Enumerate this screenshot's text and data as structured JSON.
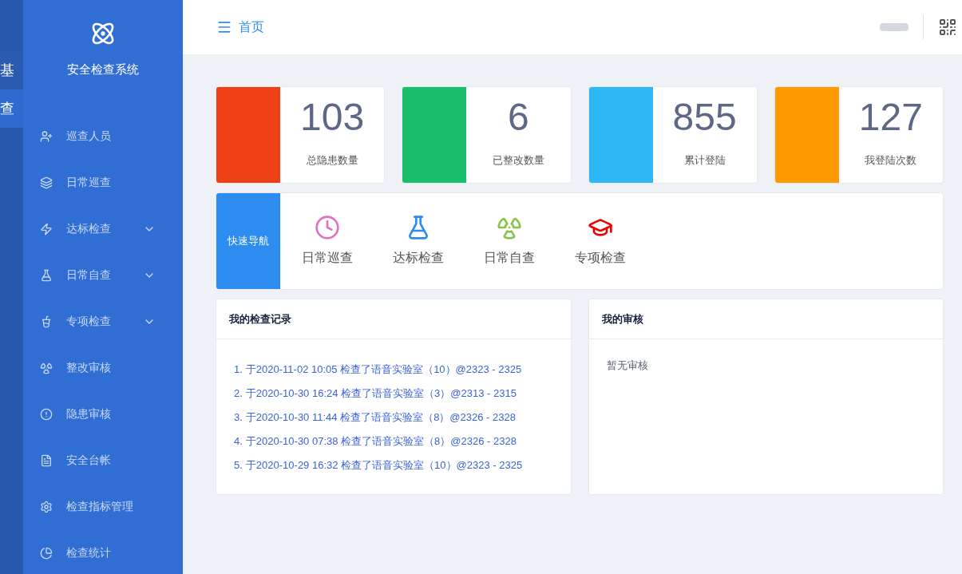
{
  "side_strip": [
    {
      "label": "基",
      "selected": false
    },
    {
      "label": "查",
      "selected": true
    }
  ],
  "brand": {
    "title": "安全检查系统"
  },
  "menu": [
    {
      "label": "巡查人员",
      "expandable": false
    },
    {
      "label": "日常巡查",
      "expandable": false
    },
    {
      "label": "达标检查",
      "expandable": true
    },
    {
      "label": "日常自查",
      "expandable": true
    },
    {
      "label": "专项检查",
      "expandable": true
    },
    {
      "label": "整改审核",
      "expandable": false
    },
    {
      "label": "隐患审核",
      "expandable": false
    },
    {
      "label": "安全台帐",
      "expandable": false
    },
    {
      "label": "检查指标管理",
      "expandable": false
    },
    {
      "label": "检查统计",
      "expandable": false
    }
  ],
  "header": {
    "breadcrumb": "首页"
  },
  "stats": [
    {
      "value": "103",
      "label": "总隐患数量",
      "color": "#ed4014"
    },
    {
      "value": "6",
      "label": "已整改数量",
      "color": "#19be6b"
    },
    {
      "value": "855",
      "label": "累计登陆",
      "color": "#2db7f5"
    },
    {
      "value": "127",
      "label": "我登陆次数",
      "color": "#ff9900"
    }
  ],
  "quick_nav": {
    "title": "快速导航",
    "items": [
      {
        "label": "日常巡查"
      },
      {
        "label": "达标检查"
      },
      {
        "label": "日常自查"
      },
      {
        "label": "专项检查"
      }
    ]
  },
  "records": {
    "title": "我的检查记录",
    "items": [
      {
        "index": "1.",
        "text": "于2020-11-02 10:05 检查了语音实验室（10）@2323 - 2325"
      },
      {
        "index": "2.",
        "text": "于2020-10-30 16:24 检查了语音实验室（3）@2313 - 2315"
      },
      {
        "index": "3.",
        "text": "于2020-10-30 11:44 检查了语音实验室（8）@2326 - 2328"
      },
      {
        "index": "4.",
        "text": "于2020-10-30 07:38 检查了语音实验室（8）@2326 - 2328"
      },
      {
        "index": "5.",
        "text": "于2020-10-29 16:32 检查了语音实验室（10）@2323 - 2325"
      }
    ]
  },
  "reviews": {
    "title": "我的审核",
    "empty": "暂无审核"
  }
}
